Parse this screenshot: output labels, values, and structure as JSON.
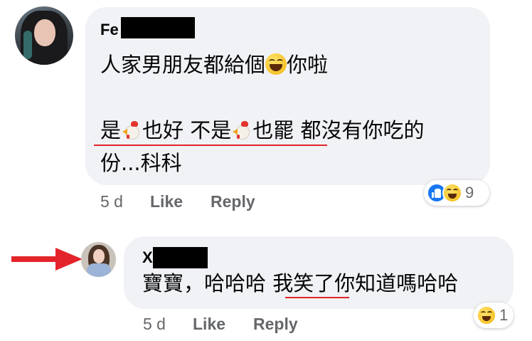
{
  "comment": {
    "author": "Fe",
    "text_line1_a": "人家男朋友都給個",
    "text_line1_b": "你啦",
    "text_line2_a": "是",
    "text_line2_b": "也好 不是",
    "text_line2_c": "也罷 都沒有你吃的",
    "text_line3": "份...科科",
    "time": "5 d",
    "like_label": "Like",
    "reply_label": "Reply",
    "reaction_count": "9",
    "reaction_icons": [
      "like-icon",
      "haha-icon"
    ]
  },
  "reply": {
    "author": "X",
    "text_a": "寶寶，哈哈哈 ",
    "text_b": "我笑了",
    "text_c": "你知道嗎哈哈",
    "time": "5 d",
    "like_label": "Like",
    "reply_label": "Reply",
    "reaction_count": "1",
    "reaction_icons": [
      "haha-icon"
    ]
  },
  "annotations": {
    "arrow_color": "#e3242b",
    "underline_color": "#e3242b"
  }
}
